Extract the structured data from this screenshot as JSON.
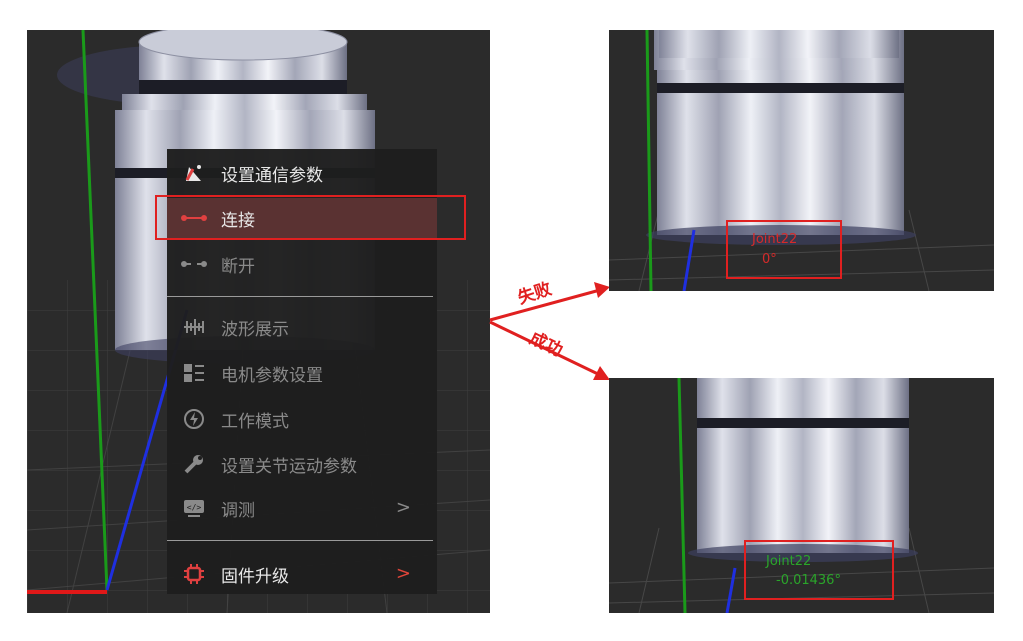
{
  "menu": {
    "items": [
      {
        "label": "设置通信参数",
        "icon": "satellite-dish-icon",
        "state": "enabled"
      },
      {
        "label": "连接",
        "icon": "link-connect-icon",
        "state": "highlighted"
      },
      {
        "label": "断开",
        "icon": "link-disconnect-icon",
        "state": "disabled"
      },
      {
        "label": "波形展示",
        "icon": "waveform-icon",
        "state": "disabled"
      },
      {
        "label": "电机参数设置",
        "icon": "motor-params-icon",
        "state": "disabled"
      },
      {
        "label": "工作模式",
        "icon": "lightning-circle-icon",
        "state": "disabled"
      },
      {
        "label": "设置关节运动参数",
        "icon": "wrench-icon",
        "state": "disabled"
      },
      {
        "label": "调测",
        "icon": "monitor-code-icon",
        "state": "disabled",
        "submenu": true
      },
      {
        "label": "固件升级",
        "icon": "chip-icon",
        "state": "enabled",
        "submenu": true
      }
    ],
    "submenu_arrow": ">"
  },
  "annotations": {
    "fail_label": "失败",
    "success_label": "成功"
  },
  "fail_view": {
    "joint_name": "Joint22",
    "joint_angle": "0°"
  },
  "success_view": {
    "joint_name": "Joint22",
    "joint_angle": "-0.01436°"
  },
  "colors": {
    "viewport_bg": "#2b2b2b",
    "grid": "#4a4a4a",
    "annotation_red": "#e02020",
    "fail_text": "#d62a2a",
    "success_text": "#2aa52a",
    "menu_highlight": "#5a3232",
    "axis_green": "#1a9a1a",
    "axis_blue": "#1f2fe0",
    "axis_red": "#e01818"
  }
}
